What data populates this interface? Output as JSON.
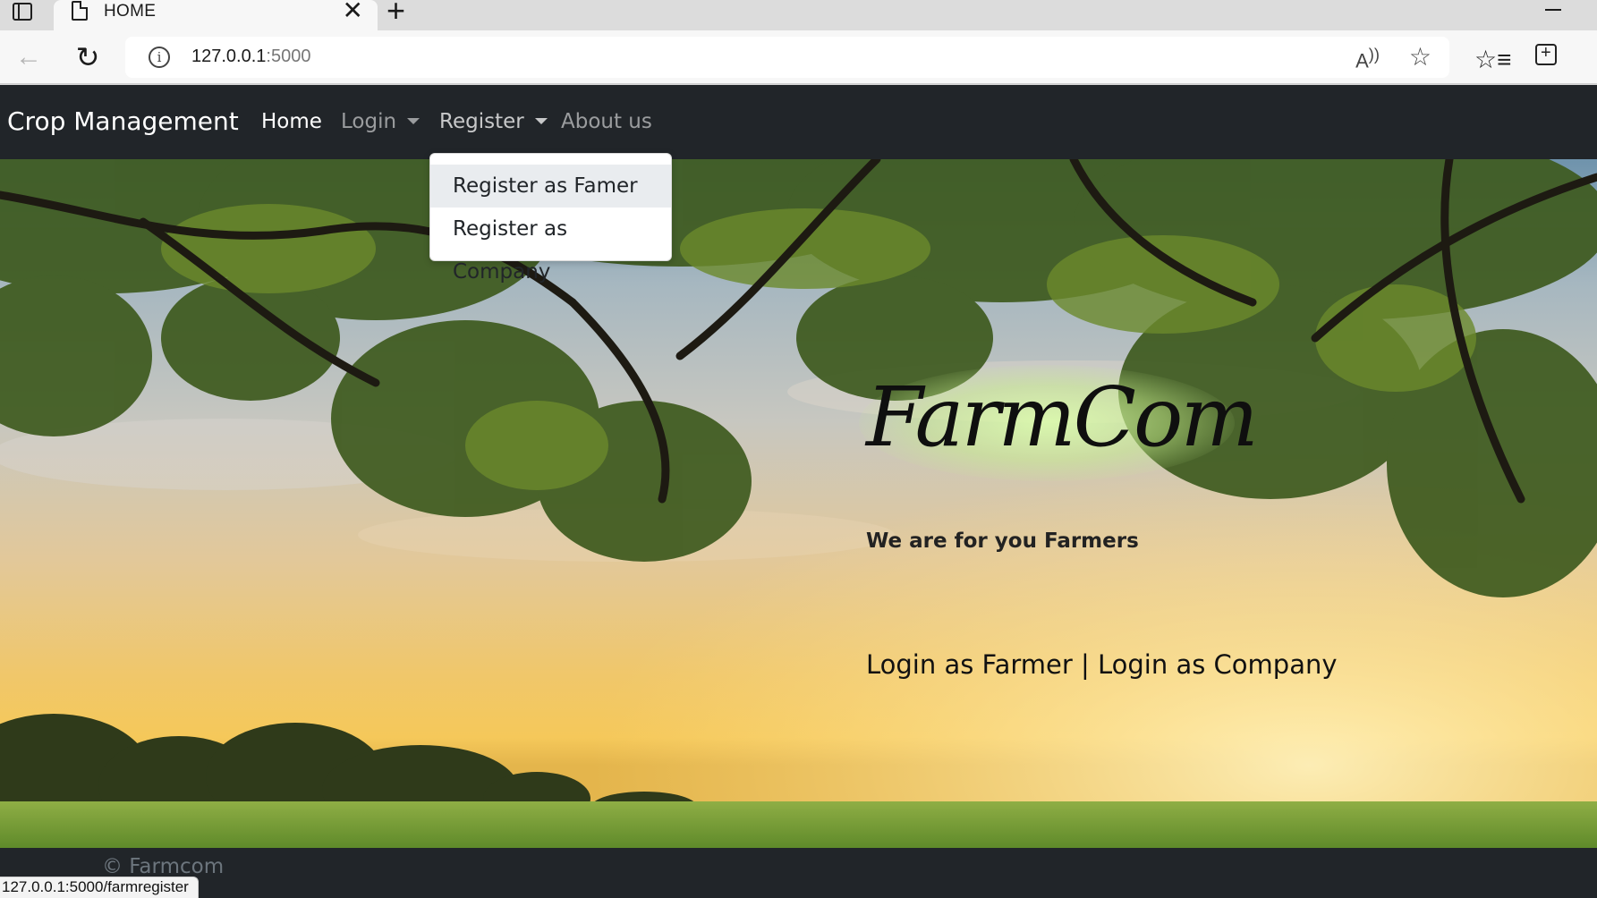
{
  "browser": {
    "tab_title": "HOME",
    "tab_close": "✕",
    "new_tab": "+",
    "url_host": "127.0.0.1",
    "url_port": ":5000",
    "status_url": "127.0.0.1:5000/farmregister"
  },
  "navbar": {
    "brand": "Crop Management",
    "items": [
      {
        "label": "Home",
        "state": "active"
      },
      {
        "label": "Login",
        "dropdown": true
      },
      {
        "label": "Register",
        "dropdown": true,
        "state": "open"
      },
      {
        "label": "About us"
      }
    ],
    "register_dropdown": [
      "Register as Famer",
      "Register as Company"
    ]
  },
  "hero": {
    "logo": "FarmCom",
    "tagline": "We are for you Farmers",
    "login_farmer": "Login as Farmer",
    "separator": " | ",
    "login_company": "Login as Company"
  },
  "footer": {
    "copyright": "© Farmcom"
  },
  "colors": {
    "navbar": "#212529",
    "dropdown_hover": "#e9ecef"
  }
}
